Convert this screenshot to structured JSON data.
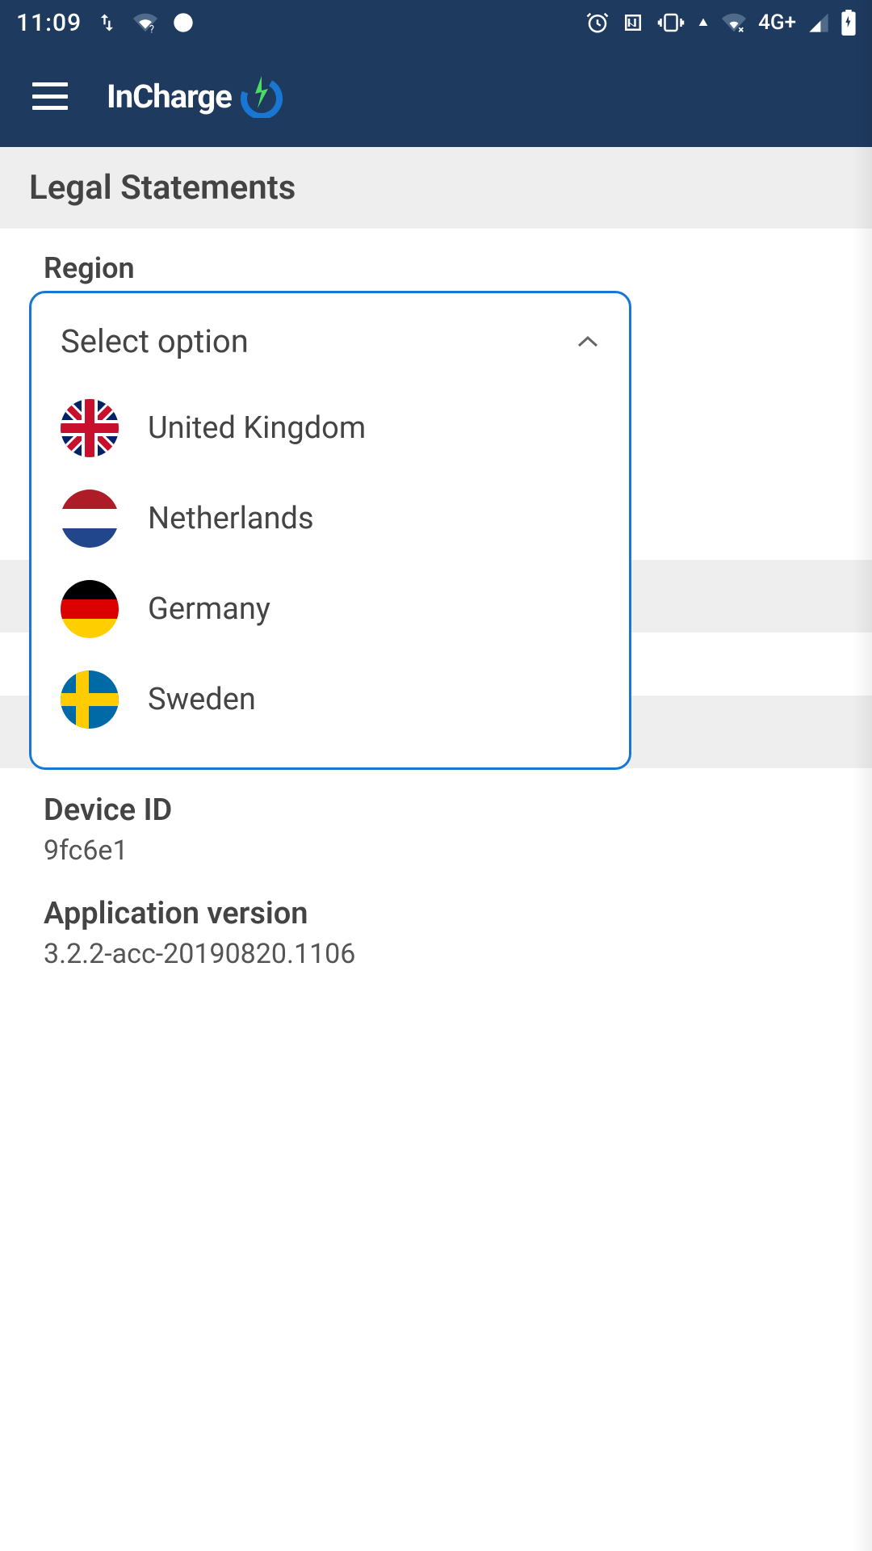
{
  "status": {
    "time": "11:09",
    "network": "4G+"
  },
  "app": {
    "name": "InCharge"
  },
  "page": {
    "title": "Legal Statements",
    "regionLabel": "Region"
  },
  "dropdown": {
    "title": "Select option",
    "options": [
      {
        "label": "United Kingdom",
        "flag": "uk"
      },
      {
        "label": "Netherlands",
        "flag": "nl"
      },
      {
        "label": "Germany",
        "flag": "de"
      },
      {
        "label": "Sweden",
        "flag": "se"
      }
    ]
  },
  "info": {
    "deviceIdLabel": "Device ID",
    "deviceIdValue": "9fc6e1",
    "appVersionLabel": "Application version",
    "appVersionValue": "3.2.2-acc-20190820.1106"
  }
}
